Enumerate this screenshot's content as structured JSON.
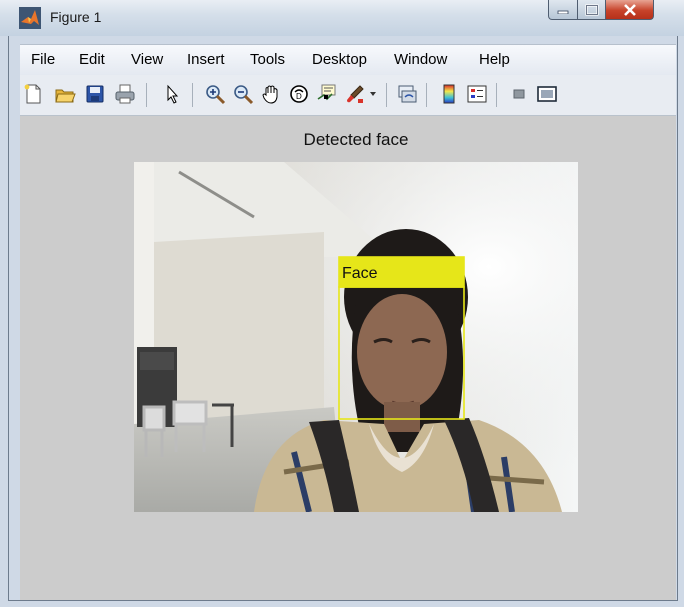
{
  "window": {
    "title": "Figure 1"
  },
  "menubar": {
    "items": [
      "File",
      "Edit",
      "View",
      "Insert",
      "Tools",
      "Desktop",
      "Window",
      "Help"
    ]
  },
  "toolbar": {
    "tools": [
      "new-figure-icon",
      "open-file-icon",
      "save-icon",
      "print-icon",
      "edit-plot-arrow-icon",
      "zoom-in-icon",
      "zoom-out-icon",
      "pan-hand-icon",
      "rotate-3d-icon",
      "data-cursor-icon",
      "brush-icon",
      "link-plot-icon",
      "insert-colorbar-icon",
      "insert-legend-icon",
      "hide-plot-tools-icon",
      "show-plot-tools-icon"
    ]
  },
  "axes": {
    "title": "Detected face"
  },
  "annotation": {
    "label": "Face",
    "color": "#e6e619"
  },
  "colors": {
    "window_frame": "#cfd9e6",
    "figure_bg": "#cccccc",
    "close_button": "#c7432a"
  }
}
